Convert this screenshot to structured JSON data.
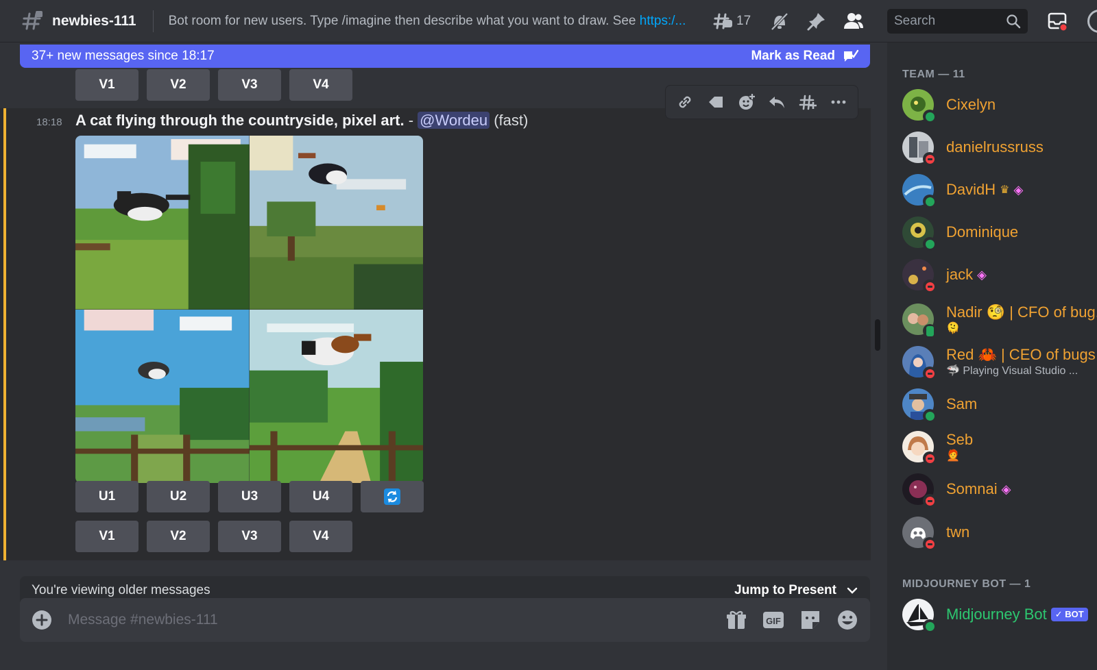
{
  "topbar": {
    "channel_name": "newbies-111",
    "topic_text": "Bot room for new users. Type /imagine then describe what you want to draw. See ",
    "topic_link": "https:/...",
    "thread_count": "17",
    "search_placeholder": "Search"
  },
  "banner": {
    "text": "37+ new messages since 18:17",
    "mark_read": "Mark as Read"
  },
  "top_buttons": [
    "V1",
    "V2",
    "V3",
    "V4"
  ],
  "message": {
    "timestamp": "18:18",
    "prompt": "A cat flying through the countryside, pixel art.",
    "separator": " - ",
    "mention": "@Wordeu",
    "speed": " (fast)",
    "upscale_buttons": [
      "U1",
      "U2",
      "U3",
      "U4"
    ],
    "variation_buttons": [
      "V1",
      "V2",
      "V3",
      "V4"
    ]
  },
  "older_bar": {
    "text": "You're viewing older messages",
    "jump": "Jump to Present"
  },
  "composer": {
    "placeholder": "Message #newbies-111",
    "gif_label": "GIF"
  },
  "members": {
    "team_header": "TEAM — 11",
    "team": [
      {
        "name": "Cixelyn",
        "status": "online",
        "color": "#7db346"
      },
      {
        "name": "danielrussruss",
        "status": "dnd",
        "color": "#8a8f97"
      },
      {
        "name": "DavidH",
        "status": "online",
        "color": "#3a7fc1",
        "badges": [
          "♛",
          "◈"
        ]
      },
      {
        "name": "Dominique",
        "status": "online",
        "color": "#2f4a36"
      },
      {
        "name": "jack",
        "status": "dnd",
        "color": "#3a3140",
        "badges": [
          "◈"
        ]
      },
      {
        "name": "Nadir 🧐 | CFO of bug...",
        "status": "mobile",
        "color": "#6b8f5e",
        "sub": "🫠"
      },
      {
        "name": "Red 🦀 | CEO of bugs",
        "status": "dnd",
        "color": "#5a7fb8",
        "sub": "🦈 Playing Visual Studio ..."
      },
      {
        "name": "Sam",
        "status": "online",
        "color": "#4e86c6"
      },
      {
        "name": "Seb",
        "status": "dnd",
        "color": "#e9d7c0",
        "sub": "🧑‍🦰"
      },
      {
        "name": "Somnai",
        "status": "dnd",
        "color": "#8a2f55",
        "badges": [
          "◈"
        ]
      },
      {
        "name": "twn",
        "status": "dnd",
        "color": "#6c6f76"
      }
    ],
    "bot_header": "MIDJOURNEY BOT — 1",
    "bot": {
      "name": "Midjourney Bot",
      "tag": "✓ BOT",
      "status": "online"
    }
  },
  "colors": {
    "accent": "#5865f2",
    "member_name": "#f0a232",
    "bot_name": "#2dc770",
    "online": "#23a55a",
    "dnd": "#f23f43",
    "highlight_bar": "#f0b232"
  }
}
